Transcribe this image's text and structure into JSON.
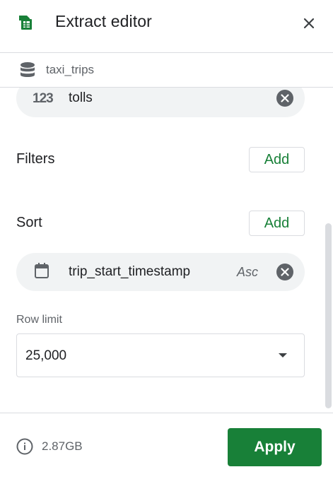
{
  "header": {
    "title": "Extract editor",
    "app_icon": "sheets-icon",
    "close_icon": "close-icon"
  },
  "source": {
    "icon": "database-icon",
    "name": "taxi_trips"
  },
  "columns": {
    "visible_chip": {
      "type_icon_text": "123",
      "label": "tolls",
      "remove_icon": "remove-circle-icon"
    }
  },
  "filters": {
    "label": "Filters",
    "add_label": "Add"
  },
  "sort": {
    "label": "Sort",
    "add_label": "Add",
    "chip": {
      "icon": "calendar-icon",
      "label": "trip_start_timestamp",
      "order": "Asc",
      "remove_icon": "remove-circle-icon"
    }
  },
  "row_limit": {
    "label": "Row limit",
    "selected": "25,000"
  },
  "footer": {
    "info_icon": "info-icon",
    "size": "2.87GB",
    "apply_label": "Apply"
  },
  "colors": {
    "accent_green": "#188038",
    "chip_bg": "#f1f3f4",
    "divider": "#dadce0",
    "icon_grey": "#5f6368"
  }
}
